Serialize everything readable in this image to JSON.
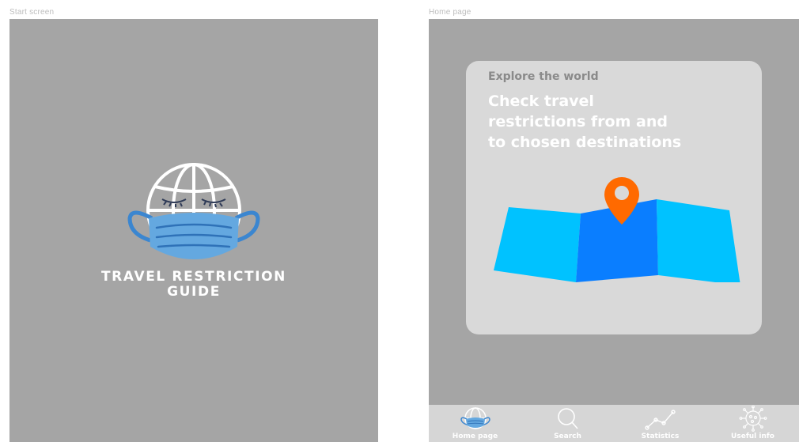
{
  "frames": {
    "start_label": "Start screen",
    "home_label": "Home page"
  },
  "start": {
    "title_line1": "TRAVEL RESTRICTION",
    "title_line2": "GUIDE",
    "logo_icon": "globe-with-face-mask-icon"
  },
  "home": {
    "eyebrow": "Explore the world",
    "headline_line1": "Check travel",
    "headline_line2": "restrictions from and",
    "headline_line3": "to chosen destinations",
    "illustration_icon": "folded-map-with-pin-icon"
  },
  "nav": {
    "items": [
      {
        "label": "Home page",
        "icon": "globe-mask-icon"
      },
      {
        "label": "Search",
        "icon": "search-icon"
      },
      {
        "label": "Statistics",
        "icon": "statistics-icon"
      },
      {
        "label": "Useful info",
        "icon": "virus-icon"
      }
    ]
  },
  "colors": {
    "screen_bg": "#a5a5a5",
    "card_bg": "#d9d9d9",
    "mask_blue": "#64a8e0",
    "map_light": "#00c2ff",
    "map_dark": "#0a7eff",
    "pin_orange": "#ff6a00",
    "nav_bg": "#d6d6d6"
  }
}
